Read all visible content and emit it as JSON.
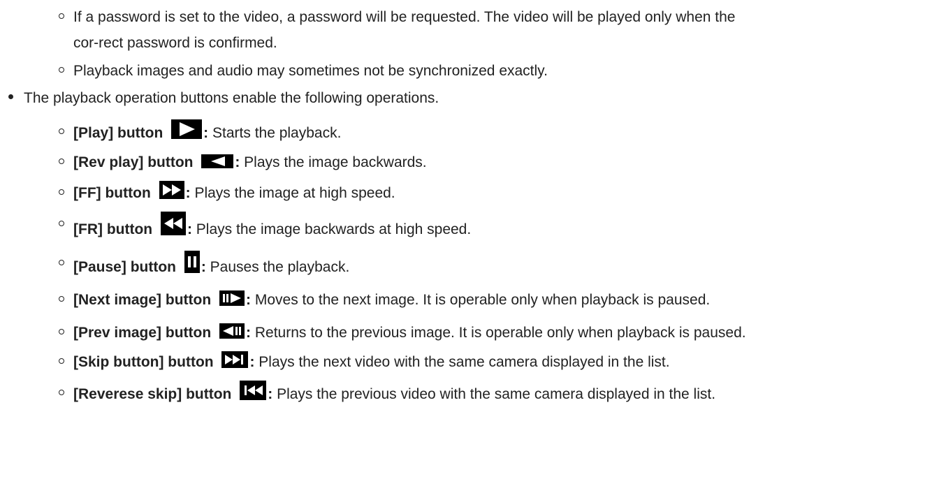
{
  "notes": [
    "If a password is set to the video, a password will be requested. The video will be played only when the",
    "cor-rect password is confirmed.",
    "Playback images and audio may sometimes not be synchronized exactly."
  ],
  "intro": "The playback operation buttons enable the following operations.",
  "buttons": [
    {
      "label": "[Play] button",
      "colon": ":",
      "desc": " Starts the playback.",
      "icon": "play-icon"
    },
    {
      "label": "[Rev play] button",
      "colon": ":",
      "desc": " Plays the image backwards.",
      "icon": "reverse-play-icon"
    },
    {
      "label": "[FF] button",
      "colon": ":",
      "desc": " Plays the image at high speed.",
      "icon": "fast-forward-icon"
    },
    {
      "label": "[FR] button",
      "colon": ":",
      "desc": " Plays the image backwards at high speed.",
      "icon": "fast-rewind-icon"
    },
    {
      "label": "[Pause] button",
      "colon": ":",
      "desc": " Pauses the playback.",
      "icon": "pause-icon"
    },
    {
      "label": "[Next image] button",
      "colon": ":",
      "desc": " Moves to the next image. It is operable only when playback is paused.",
      "icon": "next-frame-icon"
    },
    {
      "label": "[Prev image] button",
      "colon": ":",
      "desc": " Returns to the previous image. It is operable only when playback is paused.",
      "icon": "prev-frame-icon"
    },
    {
      "label": "[Skip button] button",
      "colon": ":",
      "desc": " Plays the next video with the same camera displayed in the list.",
      "icon": "skip-next-icon"
    },
    {
      "label": "[Reverese skip] button",
      "colon": ":",
      "desc": " Plays the previous video with the same camera displayed in the list.",
      "icon": "skip-previous-icon"
    }
  ]
}
